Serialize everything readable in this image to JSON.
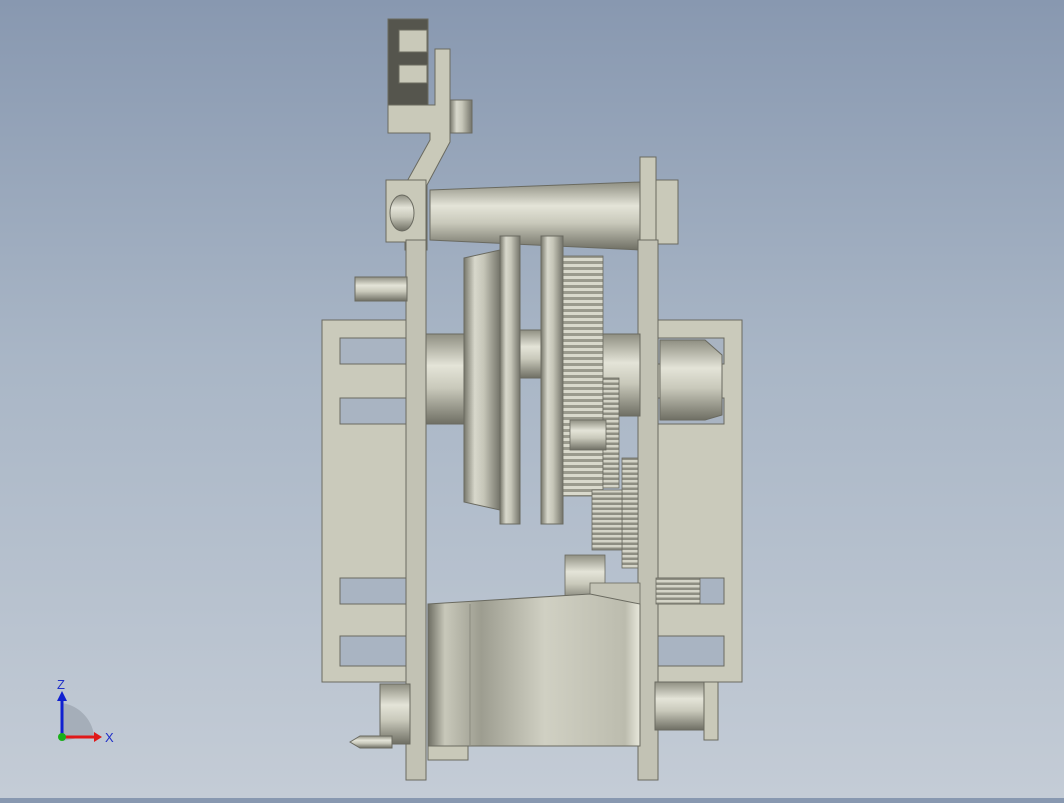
{
  "viewport": {
    "background_top": "#8898b0",
    "background_bottom": "#c4ccd6",
    "model_color": "#c9c9b9"
  },
  "triad": {
    "z_label": "Z",
    "x_label": "X",
    "z_color": "#1020d0",
    "x_color": "#e01818",
    "y_color": "#18b018"
  }
}
